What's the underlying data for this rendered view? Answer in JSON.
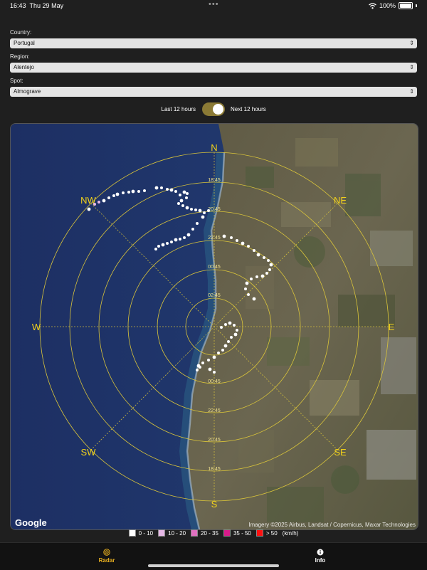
{
  "status_bar": {
    "time": "16:43",
    "date": "Thu 29 May",
    "battery": "100%",
    "icons": [
      "wifi-icon",
      "battery-icon"
    ]
  },
  "filters": {
    "country": {
      "label": "Country:",
      "value": "Portugal"
    },
    "region": {
      "label": "Region:",
      "value": "Alentejo"
    },
    "spot": {
      "label": "Spot:",
      "value": "Almograve"
    }
  },
  "time_toggle": {
    "left_label": "Last 12 hours",
    "right_label": "Next 12 hours",
    "selected": "Next 12 hours"
  },
  "radar": {
    "compass": {
      "n": "N",
      "ne": "NE",
      "e": "E",
      "se": "SE",
      "s": "S",
      "sw": "SW",
      "w": "W",
      "nw": "NW"
    },
    "north_ring_labels": [
      "18:45",
      "20:45",
      "22:45",
      "00:45",
      "02:45"
    ],
    "south_ring_labels": [
      "00:45",
      "22:45",
      "20:45",
      "18:45"
    ],
    "attribution": "Imagery ©2025 Airbus, Landsat / Copernicus, Maxar Technologies",
    "google_logo": "Google"
  },
  "legend": {
    "unit": "(km/h)",
    "items": [
      {
        "label": "0 - 10",
        "color": "#ffffff"
      },
      {
        "label": "10 - 20",
        "color": "#e6b8e6"
      },
      {
        "label": "20 - 35",
        "color": "#e070c0"
      },
      {
        "label": "35 - 50",
        "color": "#d81b8a"
      },
      {
        "label": "> 50",
        "color": "#ff1010"
      }
    ]
  },
  "tabs": [
    {
      "label": "Radar",
      "color": "#e8b020",
      "icon": "radar-icon",
      "active": true
    },
    {
      "label": "Info",
      "color": "#ffffff",
      "icon": "info-icon",
      "active": false
    }
  ],
  "colors": {
    "accent": "#e8b020",
    "ring": "#d9c43a",
    "toggle": "#8b7a35"
  }
}
